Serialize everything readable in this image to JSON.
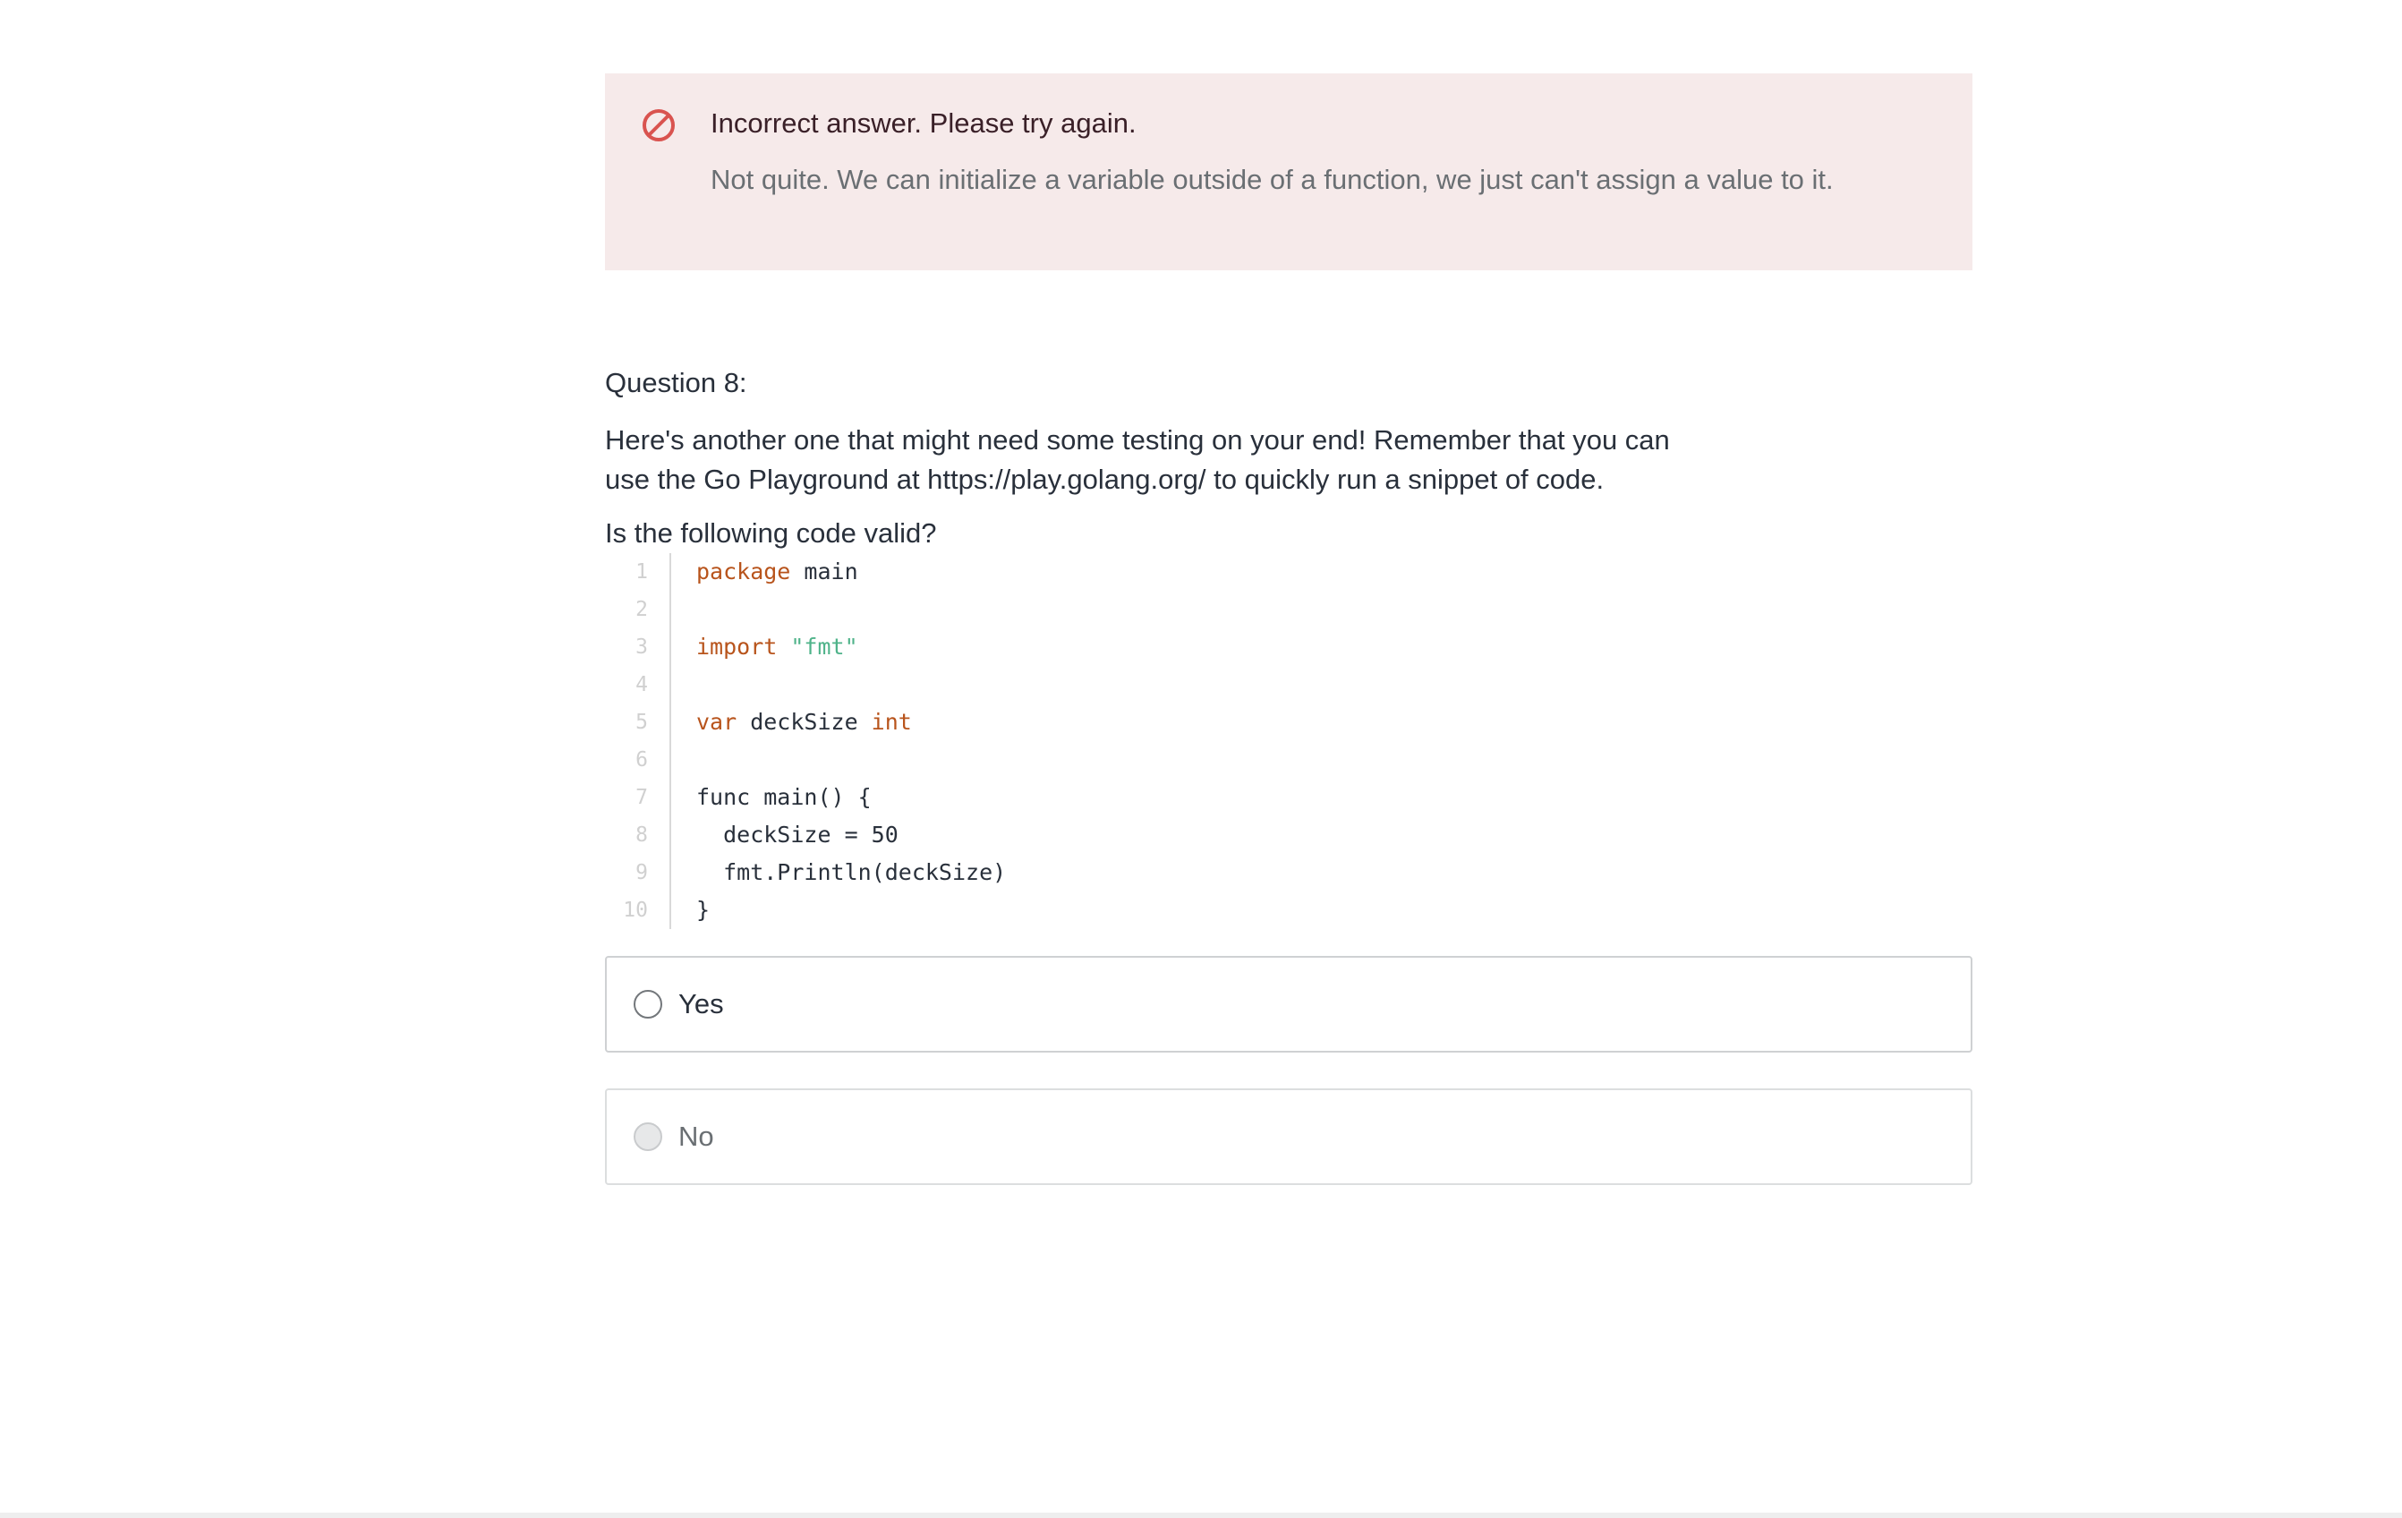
{
  "alert": {
    "icon": "prohibited-icon",
    "icon_color": "#d9534f",
    "title": "Incorrect answer. Please try again.",
    "message": "Not quite. We can initialize a variable outside of a function, we just can't assign a value to it."
  },
  "question": {
    "number_label": "Question 8:",
    "body": "Here's another one that might need some testing on your end! Remember that you can use the Go Playground at https://play.golang.org/ to quickly run a snippet of code.",
    "prompt": "Is the following code valid?"
  },
  "code": {
    "line_numbers": [
      "1",
      "2",
      "3",
      "4",
      "5",
      "6",
      "7",
      "8",
      "9",
      "10"
    ],
    "lines": [
      [
        {
          "t": "package",
          "k": "kw"
        },
        {
          "t": " main",
          "k": ""
        }
      ],
      [],
      [
        {
          "t": "import",
          "k": "kw"
        },
        {
          "t": " ",
          "k": ""
        },
        {
          "t": "\"fmt\"",
          "k": "str"
        }
      ],
      [],
      [
        {
          "t": "var",
          "k": "kw"
        },
        {
          "t": " deckSize ",
          "k": ""
        },
        {
          "t": "int",
          "k": "kw"
        }
      ],
      [],
      [
        {
          "t": "func main() {",
          "k": ""
        }
      ],
      [
        {
          "t": "  deckSize = 50",
          "k": ""
        }
      ],
      [
        {
          "t": "  fmt.Println(deckSize)",
          "k": ""
        }
      ],
      [
        {
          "t": "}",
          "k": ""
        }
      ]
    ]
  },
  "options": [
    {
      "label": "Yes",
      "state": "enabled"
    },
    {
      "label": "No",
      "state": "disabled"
    }
  ]
}
